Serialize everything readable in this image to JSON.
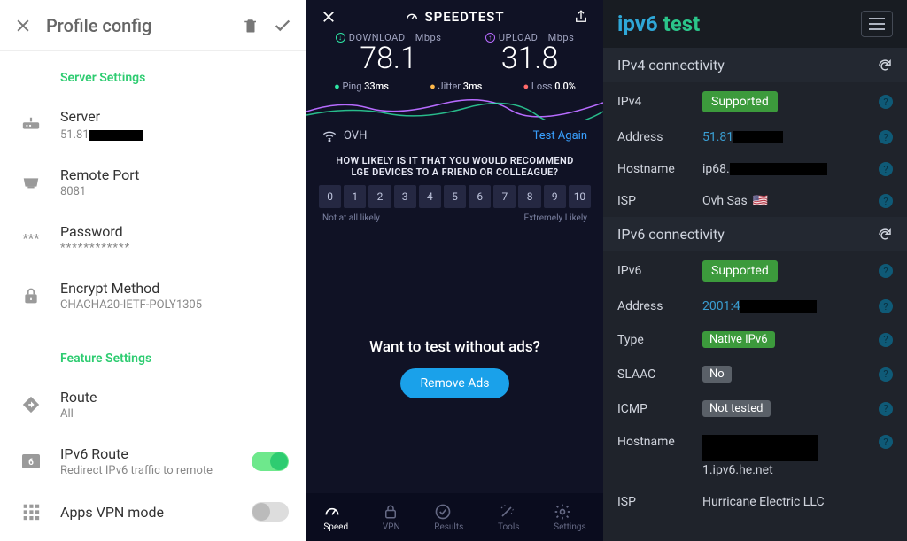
{
  "panel1": {
    "title": "Profile config",
    "section1": "Server Settings",
    "server": {
      "label": "Server",
      "value_prefix": "51.81"
    },
    "remote_port": {
      "label": "Remote Port",
      "value": "8081"
    },
    "password": {
      "label": "Password",
      "value": "************"
    },
    "encrypt": {
      "label": "Encrypt Method",
      "value": "CHACHA20-IETF-POLY1305"
    },
    "section2": "Feature Settings",
    "route": {
      "label": "Route",
      "value": "All"
    },
    "ipv6route": {
      "label": "IPv6 Route",
      "value": "Redirect IPv6 traffic to remote"
    },
    "appsvpn": {
      "label": "Apps VPN mode"
    }
  },
  "panel2": {
    "brand": "SPEEDTEST",
    "download": {
      "label": "DOWNLOAD",
      "unit": "Mbps",
      "value": "78.1"
    },
    "upload": {
      "label": "UPLOAD",
      "unit": "Mbps",
      "value": "31.8"
    },
    "ping": {
      "label": "Ping",
      "value": "33ms"
    },
    "jitter": {
      "label": "Jitter",
      "value": "3ms"
    },
    "loss": {
      "label": "Loss",
      "value": "0.0%"
    },
    "provider": "OVH",
    "test_again": "Test Again",
    "survey_q": "HOW LIKELY IS IT THAT YOU WOULD RECOMMEND LGE DEVICES TO A FRIEND OR COLLEAGUE?",
    "likert": [
      "0",
      "1",
      "2",
      "3",
      "4",
      "5",
      "6",
      "7",
      "8",
      "9",
      "10"
    ],
    "likert_low": "Not at all likely",
    "likert_high": "Extremely Likely",
    "ad_headline": "Want to test without ads?",
    "ad_button": "Remove Ads",
    "nav": {
      "speed": "Speed",
      "vpn": "VPN",
      "results": "Results",
      "tools": "Tools",
      "settings": "Settings"
    }
  },
  "panel3": {
    "logo1": "ipv6",
    "logo2": "test",
    "ipv4_head": "IPv4 connectivity",
    "ipv4": {
      "k": "IPv4",
      "v": "Supported",
      "address_k": "Address",
      "address_prefix": "51.81",
      "hostname_k": "Hostname",
      "hostname_prefix": "ip68.",
      "isp_k": "ISP",
      "isp_v": "Ovh Sas"
    },
    "ipv6_head": "IPv6 connectivity",
    "ipv6": {
      "k": "IPv6",
      "v": "Supported",
      "address_k": "Address",
      "address_prefix": "2001:4",
      "type_k": "Type",
      "type_v": "Native IPv6",
      "slaac_k": "SLAAC",
      "slaac_v": "No",
      "icmp_k": "ICMP",
      "icmp_v": "Not tested",
      "hostname_k": "Hostname",
      "hostname_suffix": "1.ipv6.he.net",
      "isp_k": "ISP",
      "isp_v": "Hurricane Electric LLC"
    }
  }
}
